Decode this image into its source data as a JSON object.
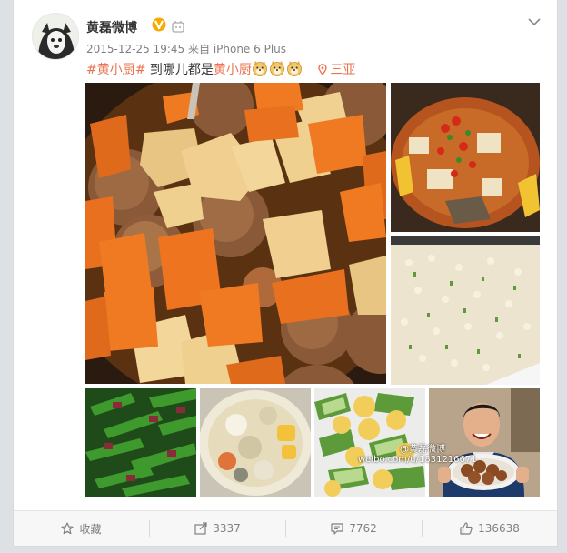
{
  "post": {
    "username": "黄磊微博",
    "timestamp": "2015-12-25 19:45",
    "source_prefix": "来自",
    "source_device": "iPhone 6 Plus",
    "topic": "#黄小厨#",
    "text_mid": "到哪儿都是",
    "text_highlight": "黄小厨",
    "location": "三亚",
    "watermark_line1": "@黄磊微博",
    "watermark_line2": "weibo.com/u/1831216671"
  },
  "icons": {
    "verified": "verified-v-icon",
    "level": "member-level-icon",
    "more": "chevron-down-icon",
    "location": "location-pin-icon",
    "emoji": "doge-emoji-icon"
  },
  "photos": [
    {
      "name": "meatball-stew-photo"
    },
    {
      "name": "fish-tofu-hotpot-photo"
    },
    {
      "name": "fried-rice-photo"
    },
    {
      "name": "snow-peas-sausage-photo"
    },
    {
      "name": "soup-photo"
    },
    {
      "name": "cucumber-egg-photo"
    },
    {
      "name": "man-with-meatballs-photo"
    }
  ],
  "toolbar": {
    "favorite_label": "收藏",
    "repost_count": "3337",
    "comment_count": "7762",
    "like_count": "136638"
  },
  "colors": {
    "accent": "#eb7350",
    "verified": "#f6ab00",
    "text": "#333333",
    "meta": "#808080"
  }
}
